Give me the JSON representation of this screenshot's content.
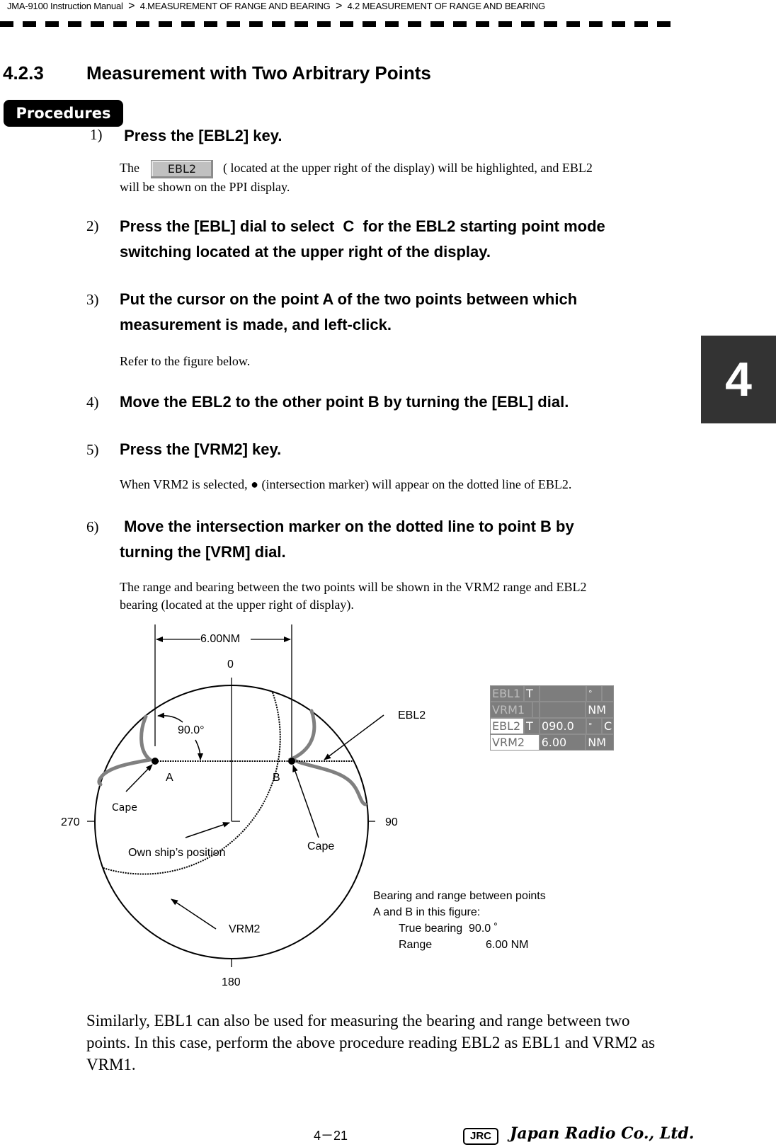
{
  "header": {
    "breadcrumb": [
      "JMA-9100 Instruction Manual",
      "4.MEASUREMENT OF RANGE AND BEARING",
      "4.2  MEASUREMENT OF RANGE AND BEARING"
    ],
    "separator": ">"
  },
  "section": {
    "number": "4.2.3",
    "title": "Measurement with Two Arbitrary Points"
  },
  "procedures_badge": "Procedures",
  "chapter_tab": "4",
  "steps": [
    {
      "num": "1)",
      "title": " Press the [EBL2] key.",
      "desc_before": "The",
      "button_label": "EBL2",
      "desc_after": "( located at the upper right of the display) will be highlighted, and EBL2",
      "desc_line2": "will be shown on the PPI display."
    },
    {
      "num": "2)",
      "title_line1": "Press the [EBL] dial to select  C  for the EBL2 starting point mode",
      "title_line2": "switching located at the upper right of the display."
    },
    {
      "num": "3)",
      "title_line1": "Put the cursor on the point A of the two points between which",
      "title_line2": "measurement is made, and left-click.",
      "desc": "Refer to the figure below."
    },
    {
      "num": "4)",
      "title": "Move the EBL2 to the other point B by turning the [EBL] dial."
    },
    {
      "num": "5)",
      "title": "Press the [VRM2] key.",
      "desc": "When VRM2 is selected, ● (intersection marker) will appear on the dotted line of EBL2."
    },
    {
      "num": "6)",
      "title_line1": " Move the intersection marker on the dotted line to point B by",
      "title_line2": "turning the [VRM] dial.",
      "desc_line1": "The range and bearing between the two points will be shown in the VRM2 range and EBL2",
      "desc_line2": "bearing (located at the upper right of display)."
    }
  ],
  "figure": {
    "distance_label": "6.00NM",
    "angle_label": "90.0°",
    "bearing_ticks": {
      "north": "0",
      "east": "90",
      "south": "180",
      "west": "270"
    },
    "point_a": "A",
    "point_b": "B",
    "cape_left": "Cape",
    "cape_right": "Cape",
    "own_ship": "Own ship’s position",
    "vrm2_label": "VRM2",
    "ebl2_label": "EBL2",
    "panel": {
      "rows": [
        {
          "name": "EBL1",
          "mode": "T",
          "value": "",
          "unit": "°",
          "extra": "",
          "active": false
        },
        {
          "name": "VRM1",
          "mode": "",
          "value": "",
          "unit": "NM",
          "extra": "",
          "active": false
        },
        {
          "name": "EBL2",
          "mode": "T",
          "value": "090.0",
          "unit": "°",
          "extra": "C",
          "active": true
        },
        {
          "name": "VRM2",
          "mode": "",
          "value": "6.00",
          "unit": "NM",
          "extra": "",
          "active": true
        }
      ]
    },
    "note": {
      "line1": "Bearing and range between points",
      "line2": "A and B in this figure:",
      "bearing_label": "True bearing",
      "bearing_value": "90.0 ˚",
      "range_label": "Range",
      "range_value": "6.00 NM"
    }
  },
  "closing_paragraph": "Similarly, EBL1 can also be used for measuring the bearing and range between two points. In this case, perform the above procedure reading EBL2 as EBL1 and VRM2 as VRM1.",
  "footer": {
    "page_number": "4－21",
    "logo_mark": "JRC",
    "company": "Japan Radio Co., Ltd."
  }
}
